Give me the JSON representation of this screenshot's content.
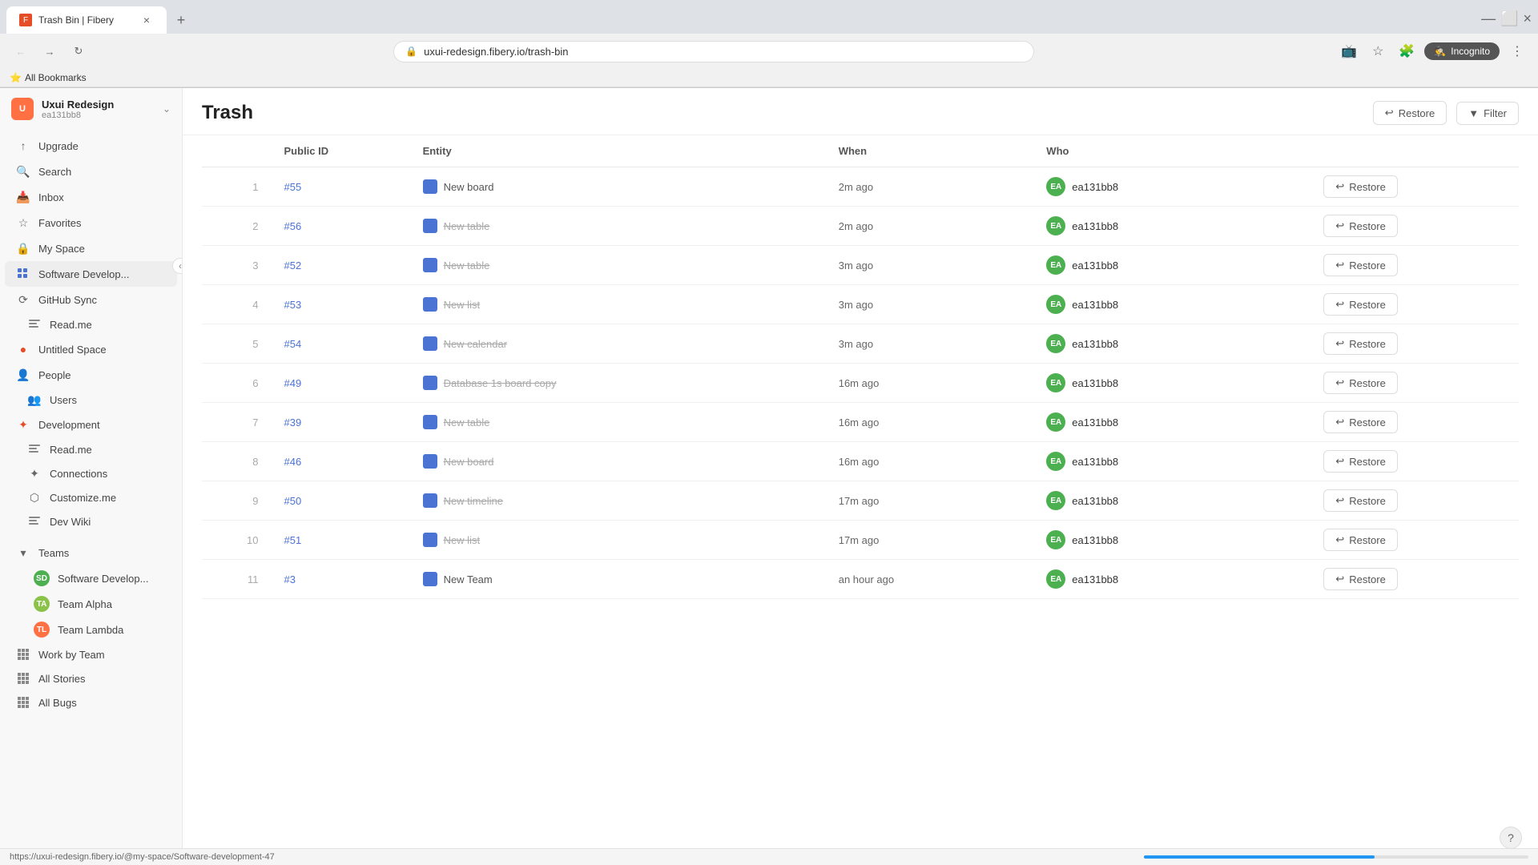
{
  "browser": {
    "tab_title": "Trash Bin | Fibery",
    "url": "uxui-redesign.fibery.io/trash-bin",
    "new_tab_label": "+",
    "bookmarks_label": "All Bookmarks",
    "incognito_label": "Incognito"
  },
  "sidebar": {
    "workspace_name": "Uxui Redesign",
    "workspace_id": "ea131bb8",
    "nav": [
      {
        "id": "upgrade",
        "label": "Upgrade",
        "icon": "upgrade"
      },
      {
        "id": "search",
        "label": "Search",
        "icon": "search"
      },
      {
        "id": "inbox",
        "label": "Inbox",
        "icon": "inbox"
      },
      {
        "id": "favorites",
        "label": "Favorites",
        "icon": "star"
      },
      {
        "id": "my-space",
        "label": "My Space",
        "icon": "lock"
      },
      {
        "id": "software-develop",
        "label": "Software Develop...",
        "icon": "grid",
        "has_actions": true
      },
      {
        "id": "github-sync",
        "label": "GitHub Sync",
        "icon": "refresh"
      },
      {
        "id": "read-me-1",
        "label": "Read.me",
        "icon": "grid-lines",
        "indent": true
      },
      {
        "id": "untitled-space",
        "label": "Untitled Space",
        "icon": "circle"
      },
      {
        "id": "people",
        "label": "People",
        "icon": "person"
      },
      {
        "id": "users",
        "label": "Users",
        "icon": "users",
        "indent": true
      },
      {
        "id": "development",
        "label": "Development",
        "icon": "dev"
      },
      {
        "id": "read-me-2",
        "label": "Read.me",
        "icon": "grid-lines",
        "indent": true
      },
      {
        "id": "connections",
        "label": "Connections",
        "icon": "connections",
        "indent": true
      },
      {
        "id": "customize-me",
        "label": "Customize.me",
        "icon": "customize",
        "indent": true
      },
      {
        "id": "dev-wiki",
        "label": "Dev Wiki",
        "icon": "wiki",
        "indent": true
      }
    ],
    "teams_section": {
      "label": "Teams",
      "collapsed": false,
      "items": [
        {
          "id": "software-develop-team",
          "label": "Software Develop...",
          "color": "#4caf50"
        },
        {
          "id": "team-alpha",
          "label": "Team Alpha",
          "color": "#8bc34a"
        },
        {
          "id": "team-lambda",
          "label": "Team Lambda",
          "color": "#ff7043"
        }
      ]
    },
    "bottom_nav": [
      {
        "id": "work-by-team",
        "label": "Work by Team",
        "icon": "grid"
      },
      {
        "id": "all-stories",
        "label": "All Stories",
        "icon": "grid"
      },
      {
        "id": "all-bugs",
        "label": "All Bugs",
        "icon": "grid"
      }
    ]
  },
  "main": {
    "title": "Trash",
    "restore_button": "Restore",
    "filter_button": "Filter",
    "table": {
      "columns": [
        "",
        "Public ID",
        "Entity",
        "When",
        "Who",
        ""
      ],
      "rows": [
        {
          "num": 1,
          "id": "#55",
          "entity": "New board",
          "entity_type": "board",
          "when": "2m ago",
          "who": "ea131bb8",
          "action": "Restore",
          "strike": false
        },
        {
          "num": 2,
          "id": "#56",
          "entity": "New table",
          "entity_type": "table",
          "when": "2m ago",
          "who": "ea131bb8",
          "action": "Restore",
          "strike": true
        },
        {
          "num": 3,
          "id": "#52",
          "entity": "New table",
          "entity_type": "table",
          "when": "3m ago",
          "who": "ea131bb8",
          "action": "Restore",
          "strike": true
        },
        {
          "num": 4,
          "id": "#53",
          "entity": "New list",
          "entity_type": "list",
          "when": "3m ago",
          "who": "ea131bb8",
          "action": "Restore",
          "strike": true
        },
        {
          "num": 5,
          "id": "#54",
          "entity": "New calendar",
          "entity_type": "calendar",
          "when": "3m ago",
          "who": "ea131bb8",
          "action": "Restore",
          "strike": true
        },
        {
          "num": 6,
          "id": "#49",
          "entity": "Database 1s board copy",
          "entity_type": "board",
          "when": "16m ago",
          "who": "ea131bb8",
          "action": "Restore",
          "strike": true
        },
        {
          "num": 7,
          "id": "#39",
          "entity": "New table",
          "entity_type": "table",
          "when": "16m ago",
          "who": "ea131bb8",
          "action": "Restore",
          "strike": true
        },
        {
          "num": 8,
          "id": "#46",
          "entity": "New board",
          "entity_type": "board",
          "when": "16m ago",
          "who": "ea131bb8",
          "action": "Restore",
          "strike": true
        },
        {
          "num": 9,
          "id": "#50",
          "entity": "New timeline",
          "entity_type": "timeline",
          "when": "17m ago",
          "who": "ea131bb8",
          "action": "Restore",
          "strike": true
        },
        {
          "num": 10,
          "id": "#51",
          "entity": "New list",
          "entity_type": "list",
          "when": "17m ago",
          "who": "ea131bb8",
          "action": "Restore",
          "strike": true
        },
        {
          "num": 11,
          "id": "#3",
          "entity": "New Team",
          "entity_type": "team",
          "when": "an hour ago",
          "who": "ea131bb8",
          "action": "Restore",
          "strike": false
        }
      ]
    }
  },
  "status_bar": {
    "url": "https://uxui-redesign.fibery.io/@my-space/Software-development-47"
  },
  "help": "?"
}
